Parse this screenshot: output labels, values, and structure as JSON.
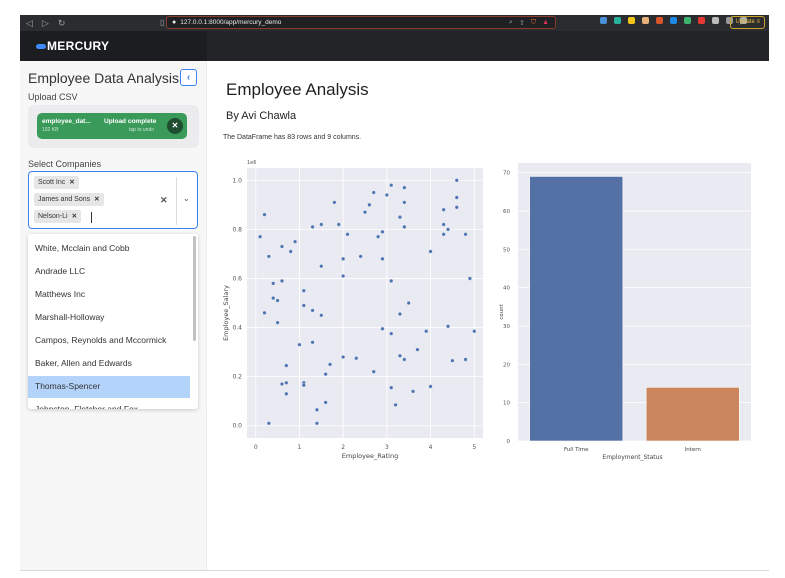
{
  "browser": {
    "url": "127.0.0.1:8000/app/mercury_demo",
    "update_label": "Update",
    "extension_colors": [
      "#4a90d9",
      "#27b39b",
      "#f5c518",
      "#e6b27a",
      "#d9542c",
      "#1e88e5",
      "#3cb371",
      "#e53935",
      "#bbbbbb",
      "#999999",
      "#aaaaaa"
    ]
  },
  "app": {
    "logo_text": "MERCURY",
    "accent": "#3b82f6"
  },
  "sidebar": {
    "title": "Employee Data Analysis",
    "collapse_glyph": "‹",
    "upload_label": "Upload CSV",
    "upload": {
      "file_name": "employee_dat...",
      "file_size": "102 KB",
      "status": "Upload complete",
      "undo_hint": "tap to undo",
      "close_glyph": "✕"
    },
    "select_label": "Select Companies",
    "selected": [
      "Scott Inc",
      "James and Sons",
      "Nelson-Li"
    ],
    "chip_remove_glyph": "✕",
    "clear_glyph": "✕",
    "chevron_glyph": "⌄",
    "options": [
      "White, Mcclain and Cobb",
      "Andrade LLC",
      "Matthews Inc",
      "Marshall-Holloway",
      "Campos, Reynolds and Mccormick",
      "Baker, Allen and Edwards",
      "Thomas-Spencer",
      "Johnston, Fletcher and Fox"
    ],
    "highlighted_option": "Thomas-Spencer"
  },
  "main": {
    "title": "Employee Analysis",
    "subtitle": "By Avi Chawla",
    "description": "The DataFrame has 83 rows and 9 columns."
  },
  "chart_data": [
    {
      "type": "scatter",
      "title": "",
      "xlabel": "Employee_Rating",
      "ylabel": "Employee_Salary",
      "y_offset_label": "1e6",
      "xlim": [
        -0.2,
        5.2
      ],
      "ylim": [
        -0.05,
        1.05
      ],
      "xticks": [
        "0",
        "1",
        "2",
        "3",
        "4",
        "5"
      ],
      "yticks": [
        "0.0",
        "0.2",
        "0.4",
        "0.6",
        "0.8",
        "1.0"
      ],
      "grid": true,
      "color": "#4c72b0",
      "points": [
        [
          0.1,
          0.77
        ],
        [
          0.2,
          0.86
        ],
        [
          0.3,
          0.69
        ],
        [
          0.4,
          0.58
        ],
        [
          0.4,
          0.52
        ],
        [
          0.5,
          0.51
        ],
        [
          0.6,
          0.59
        ],
        [
          0.6,
          0.73
        ],
        [
          0.8,
          0.71
        ],
        [
          0.9,
          0.75
        ],
        [
          0.2,
          0.46
        ],
        [
          0.5,
          0.42
        ],
        [
          1.1,
          0.55
        ],
        [
          1.1,
          0.49
        ],
        [
          1.3,
          0.47
        ],
        [
          1.5,
          0.45
        ],
        [
          1.3,
          0.81
        ],
        [
          1.5,
          0.82
        ],
        [
          1.5,
          0.65
        ],
        [
          1.8,
          0.91
        ],
        [
          1.9,
          0.82
        ],
        [
          2.0,
          0.68
        ],
        [
          2.0,
          0.61
        ],
        [
          2.1,
          0.78
        ],
        [
          2.4,
          0.69
        ],
        [
          2.5,
          0.87
        ],
        [
          2.6,
          0.9
        ],
        [
          2.7,
          0.95
        ],
        [
          2.8,
          0.77
        ],
        [
          2.9,
          0.68
        ],
        [
          2.9,
          0.79
        ],
        [
          3.0,
          0.94
        ],
        [
          3.1,
          0.98
        ],
        [
          3.1,
          0.59
        ],
        [
          3.3,
          0.85
        ],
        [
          3.4,
          0.97
        ],
        [
          3.4,
          0.91
        ],
        [
          3.4,
          0.81
        ],
        [
          3.5,
          0.5
        ],
        [
          4.0,
          0.71
        ],
        [
          4.3,
          0.88
        ],
        [
          4.3,
          0.82
        ],
        [
          4.3,
          0.78
        ],
        [
          4.4,
          0.8
        ],
        [
          4.6,
          1.0
        ],
        [
          4.6,
          0.93
        ],
        [
          4.6,
          0.89
        ],
        [
          4.8,
          0.78
        ],
        [
          4.9,
          0.6
        ],
        [
          1.0,
          0.33
        ],
        [
          1.3,
          0.34
        ],
        [
          0.7,
          0.245
        ],
        [
          0.6,
          0.17
        ],
        [
          0.7,
          0.175
        ],
        [
          1.1,
          0.175
        ],
        [
          1.1,
          0.165
        ],
        [
          0.7,
          0.13
        ],
        [
          1.7,
          0.25
        ],
        [
          1.6,
          0.21
        ],
        [
          2.0,
          0.28
        ],
        [
          2.3,
          0.275
        ],
        [
          2.7,
          0.22
        ],
        [
          1.6,
          0.095
        ],
        [
          1.4,
          0.065
        ],
        [
          1.4,
          0.01
        ],
        [
          0.3,
          0.01
        ],
        [
          2.9,
          0.395
        ],
        [
          3.1,
          0.375
        ],
        [
          3.3,
          0.455
        ],
        [
          3.3,
          0.285
        ],
        [
          3.4,
          0.27
        ],
        [
          3.7,
          0.31
        ],
        [
          3.9,
          0.385
        ],
        [
          4.4,
          0.405
        ],
        [
          4.5,
          0.265
        ],
        [
          4.8,
          0.27
        ],
        [
          5.0,
          0.385
        ],
        [
          3.1,
          0.155
        ],
        [
          3.6,
          0.14
        ],
        [
          4.0,
          0.16
        ],
        [
          3.2,
          0.085
        ]
      ]
    },
    {
      "type": "bar",
      "title": "",
      "xlabel": "Employment_Status",
      "ylabel": "count",
      "categories": [
        "Full Time",
        "Intern"
      ],
      "values": [
        69,
        14
      ],
      "colors": [
        "#5471a6",
        "#cc865e"
      ],
      "ylim": [
        0,
        72.5
      ],
      "yticks": [
        "0",
        "10",
        "20",
        "30",
        "40",
        "50",
        "60",
        "70"
      ],
      "grid": true
    }
  ]
}
